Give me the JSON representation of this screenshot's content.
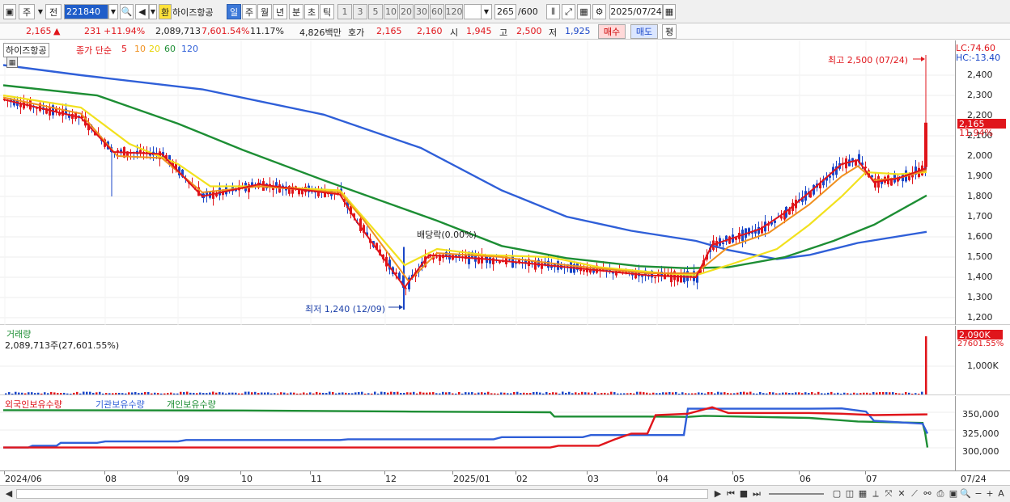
{
  "toolbar": {
    "market": "주",
    "exchange": "전",
    "code": "221840",
    "search_icon": "search-icon",
    "stock_badge": "환",
    "stock_name": "하이즈항공",
    "periods": [
      "일",
      "주",
      "월",
      "년",
      "분",
      "초",
      "틱"
    ],
    "active_period": "일",
    "counts": [
      "1",
      "3",
      "5",
      "10",
      "20",
      "30",
      "60",
      "120"
    ],
    "bar_count": "265",
    "bar_max": "/600",
    "date": "2025/07/24"
  },
  "quote": {
    "price": "2,165",
    "arrow": "▲",
    "change": "231",
    "change_pct": "+11.94%",
    "volume": "2,089,713",
    "volume_pct": "7,601.54%",
    "turnover": "11.17%",
    "amount": "4,826백만",
    "hoga_label": "호가",
    "ask": "2,165",
    "bid": "2,160",
    "open_label": "시",
    "open": "1,945",
    "high_label": "고",
    "high": "2,500",
    "low_label": "저",
    "low": "1,925",
    "buy_label": "매수",
    "sell_label": "매도",
    "eval_label": "평"
  },
  "price_pane": {
    "legend_name": "하이즈항공",
    "legend_ma_label": "종가 단순",
    "ma_periods": [
      "5",
      "10",
      "20",
      "60",
      "120"
    ],
    "ma_colors": [
      "#e0151b",
      "#f0901e",
      "#f2e11e",
      "#1d8e34",
      "#2f5fd8"
    ],
    "lc": "LC:74.60",
    "hc": "HC:-13.40",
    "high_annot": "최고 2,500 (07/24)",
    "low_annot": "최저 1,240 (12/09)",
    "dividend_annot": "배당락(0.00%)",
    "last_price_tag": "2,165",
    "last_pct_tag": "11.94%",
    "y_ticks": [
      "2,400",
      "2,300",
      "2,200",
      "2,100",
      "2,000",
      "1,900",
      "1,800",
      "1,700",
      "1,600",
      "1,500",
      "1,400",
      "1,300",
      "1,200"
    ]
  },
  "volume_pane": {
    "title": "거래량",
    "value": "2,089,713주(27,601.55%)",
    "tag": "2,090K",
    "tag_pct": "27601.55%",
    "y_ticks": [
      "1,000K"
    ]
  },
  "holdings_pane": {
    "series": [
      "외국인보유수량",
      "기관보유수량",
      "개인보유수량"
    ],
    "colors": [
      "#e0151b",
      "#2f5fd8",
      "#1d8e34"
    ],
    "y_ticks": [
      "350,000",
      "325,000",
      "300,000"
    ]
  },
  "x_axis": {
    "labels": [
      "2024/06",
      "08",
      "09",
      "10",
      "11",
      "12",
      "2025/01",
      "02",
      "03",
      "04",
      "05",
      "06",
      "07"
    ],
    "last": "07/24"
  },
  "chart_data": {
    "type": "candlestick",
    "series": [
      {
        "name": "5",
        "values": [
          2290,
          2230,
          2160,
          2080,
          1960,
          1990,
          1950,
          1830,
          1860,
          1870,
          1850,
          1830,
          1600,
          1360,
          1520,
          1470,
          1490,
          1490,
          1470,
          1430,
          1400,
          1410,
          1390,
          1390,
          1540,
          1600,
          1700,
          1820,
          1950,
          1900,
          1950,
          2165
        ]
      },
      {
        "name": "120",
        "values": [
          2400,
          2350,
          2300,
          2240,
          2180,
          2110,
          2020,
          1940,
          1850,
          1760,
          1670,
          1600,
          1560,
          1520,
          1505,
          1495,
          1515,
          1540,
          1560,
          1580,
          1600,
          1620
        ]
      }
    ],
    "high": 2500,
    "low": 1240,
    "last": 2165,
    "ylim": [
      1150,
      2500
    ]
  }
}
